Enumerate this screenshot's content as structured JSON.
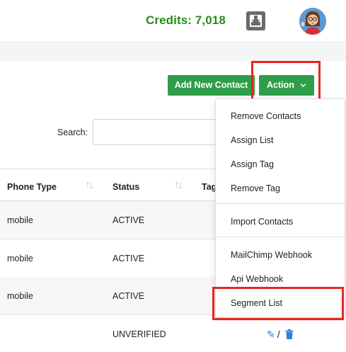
{
  "header": {
    "credits": "Credits: 7,018",
    "download_icon": "download-icon",
    "avatar_icon": "avatar"
  },
  "toolbar": {
    "add_new_contact": "Add New Contact",
    "action": "Action",
    "action_chevron": "⌵"
  },
  "search": {
    "label": "Search:",
    "value": ""
  },
  "table": {
    "columns": [
      "Phone Type",
      "Status",
      "Tag"
    ],
    "sort_glyph": "↑↓",
    "rows": [
      {
        "phone_type": "mobile",
        "status": "ACTIVE"
      },
      {
        "phone_type": "mobile",
        "status": "ACTIVE"
      },
      {
        "phone_type": "mobile",
        "status": "ACTIVE"
      },
      {
        "phone_type": "",
        "status": "UNVERIFIED"
      }
    ],
    "edit_glyph": "✎",
    "separator": "/",
    "delete_glyph": "🗑"
  },
  "action_menu": {
    "items": [
      "Remove Contacts",
      "Assign List",
      "Assign Tag",
      "Remove Tag",
      "Import Contacts",
      "MailChimp Webhook",
      "Api Webhook",
      "Segment List"
    ]
  },
  "colors": {
    "credits": "#2b8a1e",
    "button_green": "#2f9e4a",
    "highlight_red": "#e8251f",
    "icon_blue": "#2f7fe0"
  }
}
